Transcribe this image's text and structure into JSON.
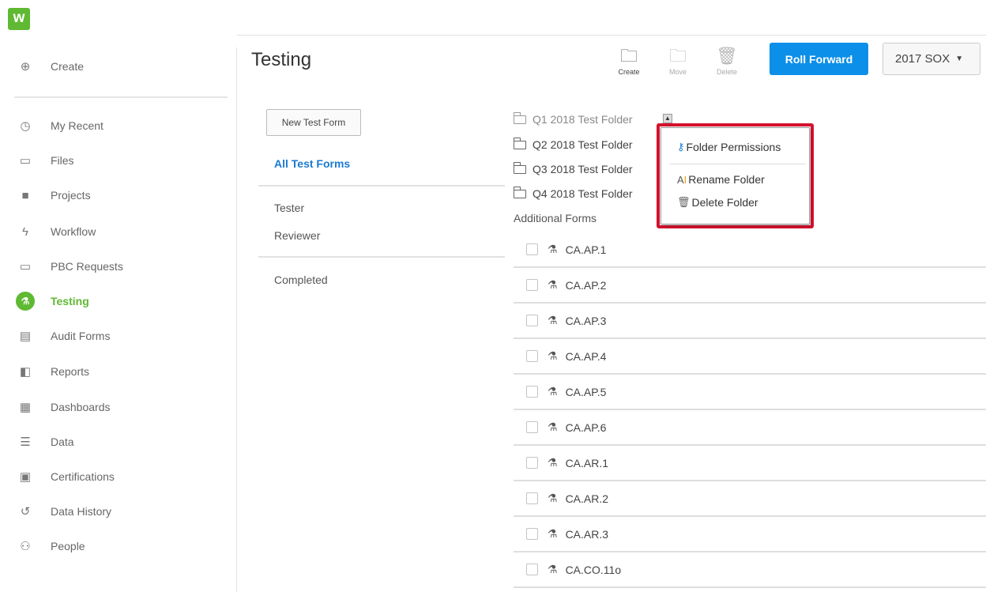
{
  "app": {
    "logo_text": "w"
  },
  "sidebar": {
    "create_label": "Create",
    "items": [
      {
        "label": "My Recent",
        "icon": "clock-icon"
      },
      {
        "label": "Files",
        "icon": "folder-icon"
      },
      {
        "label": "Projects",
        "icon": "briefcase-icon"
      },
      {
        "label": "Workflow",
        "icon": "lightning-icon"
      },
      {
        "label": "PBC Requests",
        "icon": "folder-request-icon"
      },
      {
        "label": "Testing",
        "icon": "flask-icon",
        "active": true
      },
      {
        "label": "Audit Forms",
        "icon": "form-icon"
      },
      {
        "label": "Reports",
        "icon": "report-icon"
      },
      {
        "label": "Dashboards",
        "icon": "dashboard-icon"
      },
      {
        "label": "Data",
        "icon": "database-icon"
      },
      {
        "label": "Certifications",
        "icon": "certificate-icon"
      },
      {
        "label": "Data History",
        "icon": "history-icon"
      },
      {
        "label": "People",
        "icon": "person-icon"
      }
    ]
  },
  "header": {
    "title": "Testing",
    "tools": {
      "create": "Create",
      "move": "Move",
      "delete": "Delete"
    },
    "roll_forward": "Roll Forward",
    "year": "2017 SOX"
  },
  "filters": {
    "new_test_form": "New Test Form",
    "all_test_forms": "All Test Forms",
    "tester": "Tester",
    "reviewer": "Reviewer",
    "completed": "Completed"
  },
  "folders": [
    "Q1 2018 Test Folder",
    "Q2 2018 Test Folder",
    "Q3 2018 Test Folder",
    "Q4 2018 Test Folder"
  ],
  "additional_forms_label": "Additional Forms",
  "forms": [
    "CA.AP.1",
    "CA.AP.2",
    "CA.AP.3",
    "CA.AP.4",
    "CA.AP.5",
    "CA.AP.6",
    "CA.AR.1",
    "CA.AR.2",
    "CA.AR.3",
    "CA.CO.11o"
  ],
  "context_menu": {
    "folder_permissions": "Folder Permissions",
    "rename_folder": "Rename Folder",
    "delete_folder": "Delete Folder"
  },
  "colors": {
    "brand_green": "#5fb932",
    "primary_blue": "#0c8fe8",
    "highlight_red": "#d5112d"
  }
}
